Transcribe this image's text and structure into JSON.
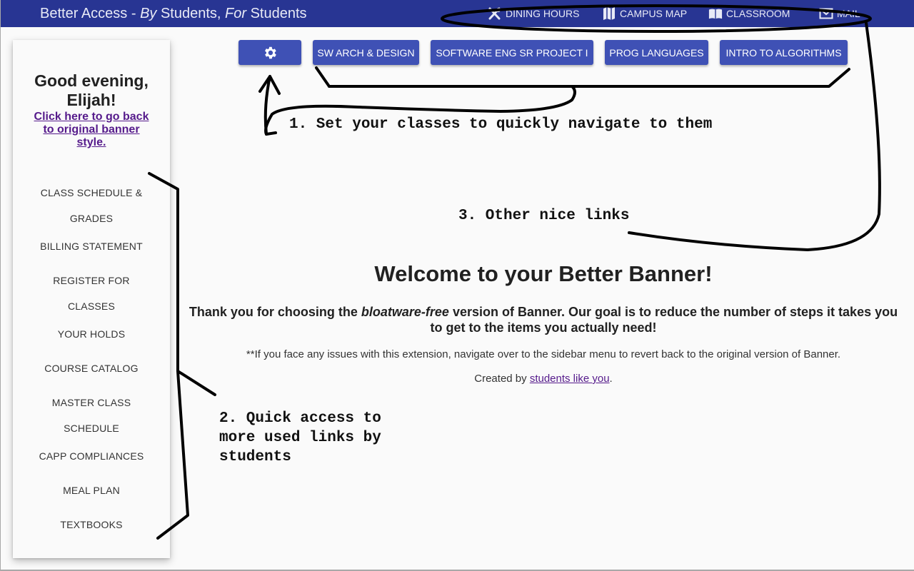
{
  "header": {
    "brand_prefix": "Better Access - ",
    "brand_by": "By",
    "brand_mid": " Students, ",
    "brand_for": "For",
    "brand_suffix": " Students",
    "links": [
      {
        "label": "DINING HOURS",
        "icon": "utensils-icon"
      },
      {
        "label": "CAMPUS MAP",
        "icon": "map-icon"
      },
      {
        "label": "CLASSROOM",
        "icon": "book-icon"
      },
      {
        "label": "MAIL",
        "icon": "mail-icon"
      }
    ]
  },
  "sidebar": {
    "greeting": "Good evening, Elijah!",
    "revert_link": "Click here to go back to original banner style.",
    "items": [
      {
        "label": "CLASS SCHEDULE & GRADES"
      },
      {
        "label": "BILLING STATEMENT"
      },
      {
        "label": "REGISTER FOR CLASSES"
      },
      {
        "label": "YOUR HOLDS"
      },
      {
        "label": "COURSE CATALOG"
      },
      {
        "label": "MASTER CLASS SCHEDULE"
      },
      {
        "label": "CAPP COMPLIANCES"
      },
      {
        "label": "MEAL PLAN"
      },
      {
        "label": "TEXTBOOKS"
      }
    ]
  },
  "classes": {
    "settings_icon": "gear-icon",
    "items": [
      {
        "label": "SW ARCH & DESIGN"
      },
      {
        "label": "SOFTWARE ENG SR PROJECT I"
      },
      {
        "label": "PROG LANGUAGES"
      },
      {
        "label": "INTRO TO ALGORITHMS"
      }
    ]
  },
  "main": {
    "title": "Welcome to your Better Banner!",
    "thanks_pre": "Thank you for choosing the ",
    "thanks_em": "bloatware-free",
    "thanks_post": " version of Banner. Our goal is to reduce the number of steps it takes you to get to the items you actually need!",
    "issues": "**If you face any issues with this extension, navigate over to the sidebar menu to revert back to the original version of Banner.",
    "created_pre": "Created by ",
    "created_link": "students like you",
    "created_post": "."
  },
  "annotations": {
    "note1": "1. Set your classes to quickly navigate to them",
    "note2": "2. Quick access to\nmore used links by\nstudents",
    "note3": "3. Other nice links"
  },
  "colors": {
    "header_bg": "#283593",
    "button_bg": "#3f51b5",
    "link_visited": "#551a8b"
  }
}
